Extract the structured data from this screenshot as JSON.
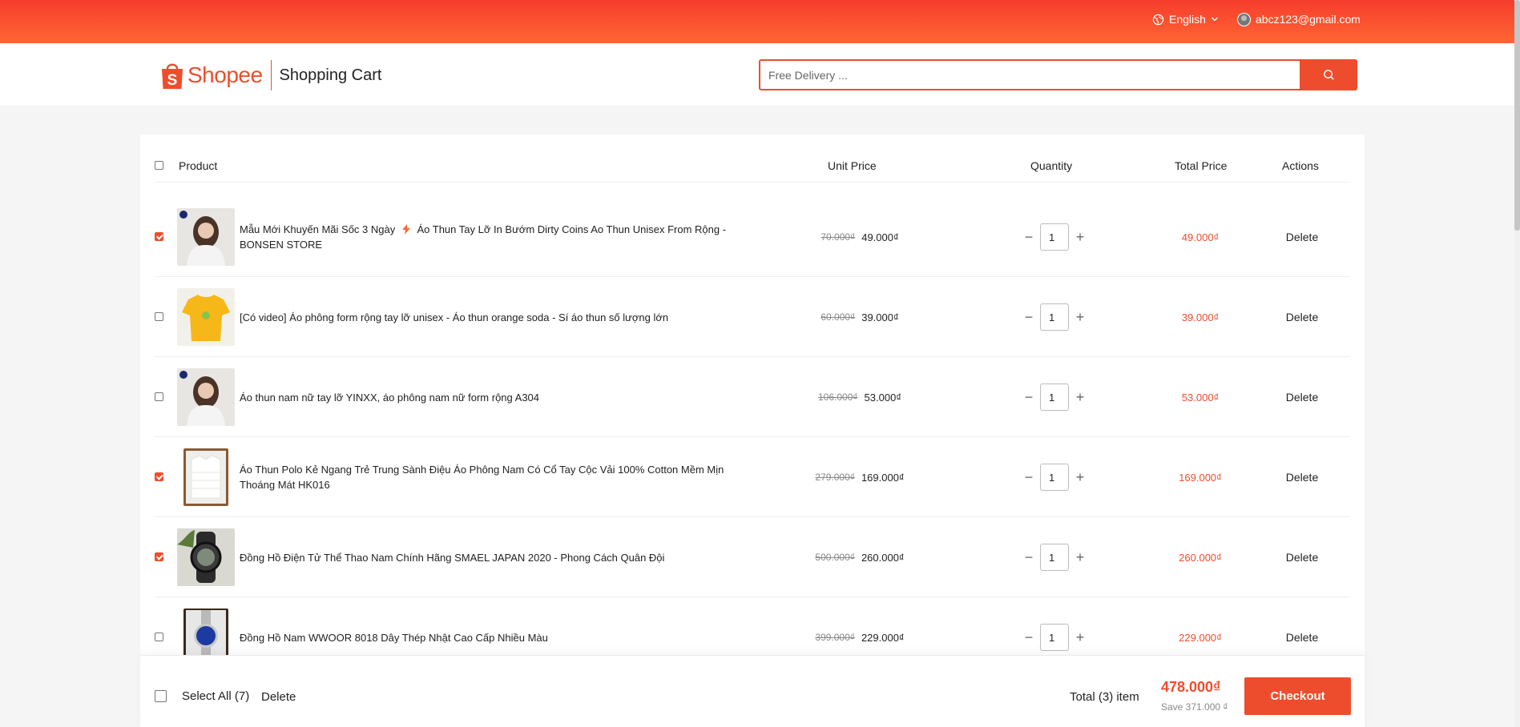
{
  "topbar": {
    "language": "English",
    "user_email": "abcz123@gmail.com"
  },
  "header": {
    "brand": "Shopee",
    "page_title": "Shopping Cart",
    "search_placeholder": "Free Delivery ..."
  },
  "table": {
    "headers": {
      "product": "Product",
      "unit_price": "Unit Price",
      "quantity": "Quantity",
      "total_price": "Total Price",
      "actions": "Actions"
    },
    "rows": [
      {
        "name_a": "Mẫu Mới Khuyến Mãi Sốc 3 Ngày",
        "name_b": "Áo Thun Tay Lỡ In Bướm Dirty Coins Ao Thun Unisex From Rộng -BONSEN STORE",
        "old_price": "70.000₫",
        "price": "49.000₫",
        "qty": "1",
        "total": "49.000₫",
        "action": "Delete",
        "checked": true
      },
      {
        "name": "[Có video] Áo phông form rộng tay lỡ unisex - Áo thun orange soda - Sí áo thun số lượng lớn",
        "old_price": "60.000₫",
        "price": "39.000₫",
        "qty": "1",
        "total": "39.000₫",
        "action": "Delete",
        "checked": false
      },
      {
        "name": "Áo thun nam nữ tay lỡ YINXX, áo phông nam nữ form rộng A304",
        "old_price": "106.000₫",
        "price": "53.000₫",
        "qty": "1",
        "total": "53.000₫",
        "action": "Delete",
        "checked": false
      },
      {
        "name": "Áo Thun Polo Kẻ Ngang Trẻ Trung Sành Điệu Áo Phông Nam Có Cổ Tay Cộc Vải 100% Cotton Mềm Mịn Thoáng Mát HK016",
        "old_price": "279.000₫",
        "price": "169.000₫",
        "qty": "1",
        "total": "169.000₫",
        "action": "Delete",
        "checked": true
      },
      {
        "name": "Đồng Hồ Điện Tử Thể Thao Nam Chính Hãng SMAEL JAPAN 2020 - Phong Cách Quân Đội",
        "old_price": "500.000₫",
        "price": "260.000₫",
        "qty": "1",
        "total": "260.000₫",
        "action": "Delete",
        "checked": true
      },
      {
        "name": "Đồng Hồ Nam WWOOR 8018 Dây Thép Nhật Cao Cấp Nhiều Màu",
        "old_price": "399.000₫",
        "price": "229.000₫",
        "qty": "1",
        "total": "229.000₫",
        "action": "Delete",
        "checked": false
      }
    ]
  },
  "footer": {
    "select_all": "Select All (7)",
    "delete": "Delete",
    "total_label": "Total (3) item",
    "total_amount": "478.000₫",
    "save": "Save 371.000 ₫",
    "checkout": "Checkout"
  },
  "colors": {
    "accent": "#ee4d2d"
  }
}
